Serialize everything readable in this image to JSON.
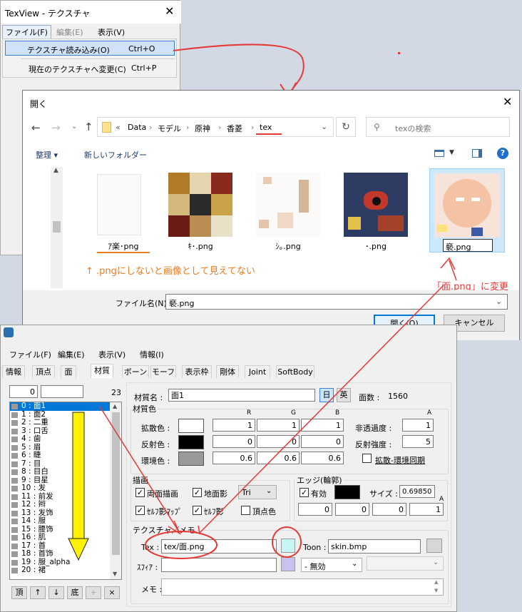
{
  "texview": {
    "title": "TexView - テクスチャ",
    "menu": [
      "ファイル(F)",
      "編集(E)",
      "表示(V)"
    ],
    "items": [
      {
        "label": "テクスチャ読み込み(O)",
        "shortcut": "Ctrl+O"
      },
      {
        "label": "現在のテクスチャへ変更(C)",
        "shortcut": "Ctrl+P"
      }
    ]
  },
  "open_dialog": {
    "title": "開く",
    "breadcrumb": [
      "«",
      "Data",
      "モデル",
      "原神",
      "香菱",
      "tex"
    ],
    "search_placeholder": "texの検索",
    "toolbar": {
      "organize": "整理 ▾",
      "new_folder": "新しいフォルダー"
    },
    "files": [
      {
        "name": "ｱ楽･png"
      },
      {
        "name": "ｷ･.png"
      },
      {
        "name": "ｼ｡.png"
      },
      {
        "name": "･.png"
      },
      {
        "name": "褻.png",
        "selected": true
      }
    ],
    "filename_label": "ファイル名(N):",
    "filename_value": "褻.png",
    "open_button": "開く(O)",
    "cancel_button": "キャンセル"
  },
  "annotations": {
    "note_png": "↑ .pngにしないと画像として見えてない",
    "note_rename": "「面.png」に変更"
  },
  "pmx": {
    "menu": [
      "ファイル(F)",
      "編集(E)",
      "表示(V)",
      "情報(I)"
    ],
    "tabs": [
      "情報",
      "頂点",
      "面",
      "材質",
      "ボーン",
      "モーフ",
      "表示枠",
      "剛体",
      "Joint",
      "SoftBody"
    ],
    "active_tab": "材質",
    "counter_left": "0",
    "counter_right": "23",
    "materials": [
      "0 : 面1",
      "1 : 面2",
      "2 : 二重",
      "3 : 口舌",
      "4 : 歯",
      "5 : 眉",
      "6 : 睫",
      "7 : 目",
      "8 : 目白",
      "9 : 目星",
      "10 : 发",
      "11 : 前发",
      "12 : 辫",
      "13 : 发饰",
      "14 : 服",
      "15 : 腰饰",
      "16 : 肌",
      "17 : 首",
      "18 : 首饰",
      "19 : 服_alpha",
      "20 : 裙"
    ],
    "list_buttons": [
      "頂",
      "↑",
      "↓",
      "底",
      "+",
      "×"
    ],
    "material_name_label": "材質名 :",
    "material_name": "面1",
    "lang_jp": "日",
    "lang_en": "英",
    "face_count_label": "面数 :",
    "face_count": "1560",
    "color_group": "材質色",
    "rgba_headers": [
      "R",
      "G",
      "B",
      "A"
    ],
    "diffuse_label": "拡散色 :",
    "diffuse": [
      "1",
      "1",
      "1"
    ],
    "specular_label": "反射色 :",
    "specular": [
      "0",
      "0",
      "0"
    ],
    "ambient_label": "環境色 :",
    "ambient": [
      "0.6",
      "0.6",
      "0.6"
    ],
    "alpha_label": "非透過度 :",
    "alpha": "1",
    "spec_power_label": "反射強度 :",
    "spec_power": "5",
    "sync_label": "拡散-環境同期",
    "draw_group": "描画",
    "draw_both": "両面描画",
    "draw_ground": "地面影",
    "draw_mode": "Tri",
    "draw_selfmap": "ｾﾙﾌ影ﾏｯﾌﾟ",
    "draw_self": "ｾﾙﾌ影",
    "draw_vcolor": "頂点色",
    "edge_group": "エッジ(輪郭)",
    "edge_enable": "有効",
    "edge_size_label": "サイズ :",
    "edge_size": "0.698508",
    "edge_a": "A",
    "edge_rgba": [
      "0",
      "0",
      "0",
      "1"
    ],
    "tex_group": "テクスチャ／メモ",
    "tex_label": "Tex :",
    "tex_value": "tex/面.png",
    "toon_label": "Toon :",
    "toon_value": "skin.bmp",
    "sphere_label": "ｽﾌｨｱ :",
    "sphere_mode": "- 無効",
    "memo_label": "メモ :",
    "colors": {
      "tex_swatch": "#c8f4f6",
      "sphere_swatch": "#c7c2ee",
      "toon_swatch": "#d7d7d7"
    }
  }
}
